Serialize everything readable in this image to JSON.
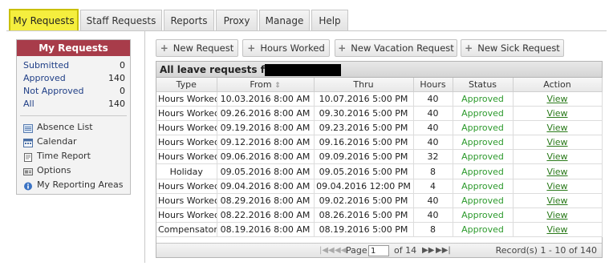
{
  "tabs": [
    {
      "label": "My Requests",
      "active": true
    },
    {
      "label": "Staff Requests"
    },
    {
      "label": "Reports"
    },
    {
      "label": "Proxy"
    },
    {
      "label": "Manage"
    },
    {
      "label": "Help"
    }
  ],
  "sidebar": {
    "title": "My Requests",
    "counts": [
      {
        "label": "Submitted",
        "count": "0"
      },
      {
        "label": "Approved",
        "count": "140"
      },
      {
        "label": "Not Approved",
        "count": "0"
      },
      {
        "label": "All",
        "count": "140"
      }
    ],
    "links": [
      {
        "label": "Absence List",
        "icon": "list-icon"
      },
      {
        "label": "Calendar",
        "icon": "calendar-icon"
      },
      {
        "label": "Time Report",
        "icon": "report-icon"
      },
      {
        "label": "Options",
        "icon": "options-icon"
      },
      {
        "label": "My Reporting Areas",
        "icon": "info-icon"
      }
    ]
  },
  "toolbar": {
    "new_request": "New Request",
    "hours_worked": "Hours Worked",
    "new_vacation": "New Vacation Request",
    "new_sick": "New Sick Request"
  },
  "grid": {
    "caption": "All leave requests for",
    "columns": [
      "Type",
      "From",
      "Thru",
      "Hours",
      "Status",
      "Action"
    ],
    "rows": [
      {
        "type": "Hours Worked",
        "from": "10.03.2016 8:00 AM",
        "thru": "10.07.2016 5:00 PM",
        "hours": "40",
        "status": "Approved",
        "action": "View"
      },
      {
        "type": "Hours Worked",
        "from": "09.26.2016 8:00 AM",
        "thru": "09.30.2016 5:00 PM",
        "hours": "40",
        "status": "Approved",
        "action": "View"
      },
      {
        "type": "Hours Worked",
        "from": "09.19.2016 8:00 AM",
        "thru": "09.23.2016 5:00 PM",
        "hours": "40",
        "status": "Approved",
        "action": "View"
      },
      {
        "type": "Hours Worked",
        "from": "09.12.2016 8:00 AM",
        "thru": "09.16.2016 5:00 PM",
        "hours": "40",
        "status": "Approved",
        "action": "View"
      },
      {
        "type": "Hours Worked",
        "from": "09.06.2016 8:00 AM",
        "thru": "09.09.2016 5:00 PM",
        "hours": "32",
        "status": "Approved",
        "action": "View"
      },
      {
        "type": "Holiday",
        "from": "09.05.2016 8:00 AM",
        "thru": "09.05.2016 5:00 PM",
        "hours": "8",
        "status": "Approved",
        "action": "View"
      },
      {
        "type": "Hours Worked",
        "from": "09.04.2016 8:00 AM",
        "thru": "09.04.2016 12:00 PM",
        "hours": "4",
        "status": "Approved",
        "action": "View"
      },
      {
        "type": "Hours Worked",
        "from": "08.29.2016 8:00 AM",
        "thru": "09.02.2016 5:00 PM",
        "hours": "40",
        "status": "Approved",
        "action": "View"
      },
      {
        "type": "Hours Worked",
        "from": "08.22.2016 8:00 AM",
        "thru": "08.26.2016 5:00 PM",
        "hours": "40",
        "status": "Approved",
        "action": "View"
      },
      {
        "type": "Compensatory",
        "from": "08.19.2016 8:00 AM",
        "thru": "08.19.2016 5:00 PM",
        "hours": "8",
        "status": "Approved",
        "action": "View"
      }
    ]
  },
  "pager": {
    "page_label": "Page",
    "page_value": "1",
    "of_label": "of 14",
    "records": "Record(s) 1 - 10 of 140"
  },
  "colors": {
    "active_tab": "#f5ee3e",
    "sidebar_header": "#a83c4a",
    "status_approved": "#2c9a2c",
    "link": "#2a7a1a"
  }
}
